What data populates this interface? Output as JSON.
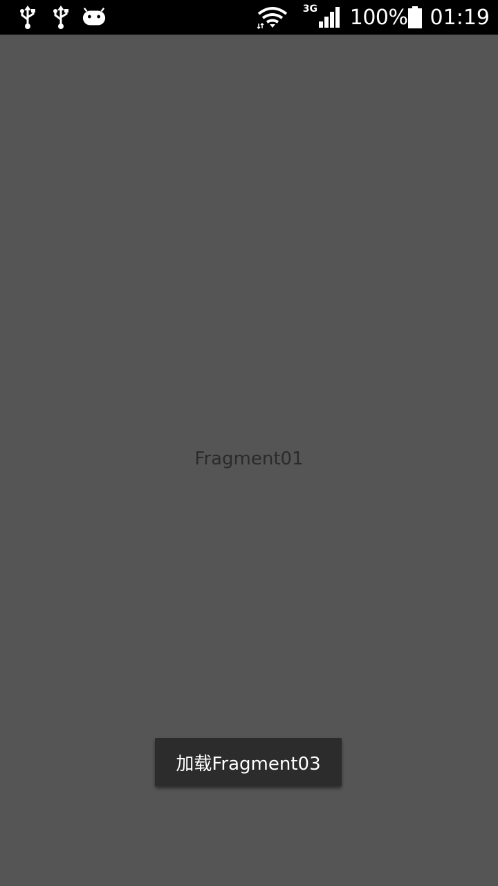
{
  "status_bar": {
    "icons": [
      "usb-icon",
      "usb-icon",
      "android-debug-icon",
      "wifi-icon",
      "cell-signal-icon",
      "battery-icon"
    ],
    "network_type": "3G",
    "battery_percent": "100%",
    "time": "01:19"
  },
  "main": {
    "fragment_text": "Fragment01",
    "load_button_label": "加载Fragment03"
  },
  "colors": {
    "background": "#555555",
    "status_bar": "#000000",
    "button": "#2c2c2c",
    "fragment_text": "#2b2b2b"
  }
}
